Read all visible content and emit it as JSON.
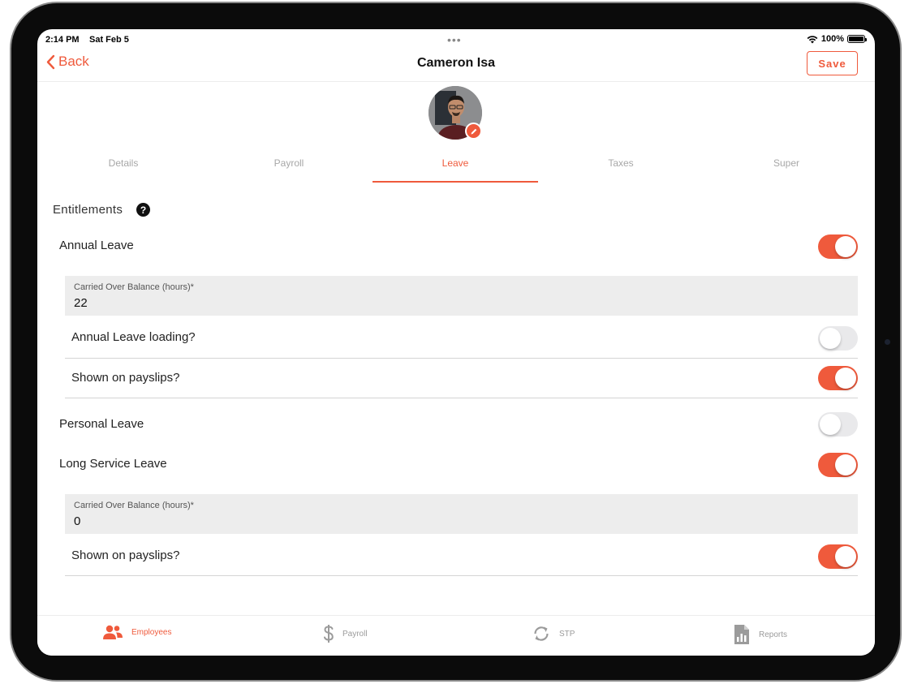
{
  "status_bar": {
    "time": "2:14 PM",
    "date": "Sat Feb 5",
    "battery": "100%"
  },
  "nav": {
    "back_label": "Back",
    "title": "Cameron Isa",
    "save_label": "Save"
  },
  "tabs": [
    {
      "label": "Details"
    },
    {
      "label": "Payroll"
    },
    {
      "label": "Leave"
    },
    {
      "label": "Taxes"
    },
    {
      "label": "Super"
    }
  ],
  "active_tab": "Leave",
  "section": {
    "title": "Entitlements",
    "help": "?"
  },
  "annual_leave": {
    "label": "Annual Leave",
    "enabled": true,
    "balance_label": "Carried Over Balance (hours)*",
    "balance_value": "22",
    "loading_label": "Annual Leave loading?",
    "loading_enabled": false,
    "payslip_label": "Shown on payslips?",
    "payslip_enabled": true
  },
  "personal_leave": {
    "label": "Personal Leave",
    "enabled": false
  },
  "long_service_leave": {
    "label": "Long Service Leave",
    "enabled": true,
    "balance_label": "Carried Over Balance (hours)*",
    "balance_value": "0",
    "payslip_label": "Shown on payslips?",
    "payslip_enabled": true
  },
  "tabbar": {
    "items": [
      {
        "label": "Employees",
        "icon": "people-icon"
      },
      {
        "label": "Payroll",
        "icon": "dollar-icon"
      },
      {
        "label": "STP",
        "icon": "sync-icon"
      },
      {
        "label": "Reports",
        "icon": "report-icon"
      }
    ],
    "active": "Employees"
  },
  "colors": {
    "accent": "#ef5a3c",
    "toggle_off": "#e9e9eb",
    "field_bg": "#ededed"
  }
}
